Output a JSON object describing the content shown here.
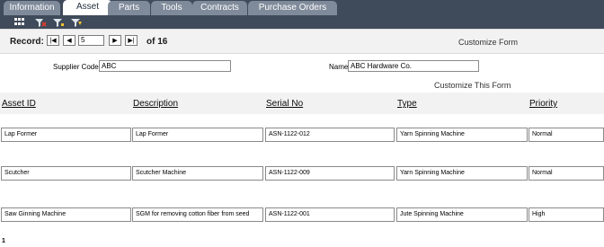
{
  "tabs": [
    {
      "label": "Information",
      "active": false
    },
    {
      "label": "Asset",
      "active": true
    },
    {
      "label": "Parts",
      "active": false
    },
    {
      "label": "Tools",
      "active": false
    },
    {
      "label": "Contracts",
      "active": false
    },
    {
      "label": "Purchase Orders",
      "active": false
    }
  ],
  "toolbar": {
    "icons": [
      "grid-view-icon",
      "clear-filter-icon",
      "filter-icon",
      "advanced-filter-icon"
    ]
  },
  "record": {
    "label": "Record:",
    "current": "5",
    "of_text": "of 16",
    "first": "|◀",
    "prev": "◀",
    "next": "▶",
    "last": "▶|"
  },
  "customize_form": "Customize Form",
  "supplier": {
    "code_label": "Supplier Code",
    "code_value": "ABC",
    "name_label": "Name",
    "name_value": "ABC Hardware Co."
  },
  "customize_this_form": "Customize This Form",
  "grid": {
    "columns": [
      "Asset ID",
      "Description",
      "Serial No",
      "Type",
      "Priority"
    ],
    "rows": [
      [
        "Lap Former",
        "Lap Former",
        "ASN-1122-012",
        "Yarn Spinning Machine",
        "Normal"
      ],
      [
        "Scutcher",
        "Scutcher Machine",
        "ASN-1122-009",
        "Yarn Spinning Machine",
        "Normal"
      ],
      [
        "Saw Ginning Machine",
        "SGM for removing cotton fiber from seed",
        "ASN-1122-001",
        "Jute Spinning Machine",
        "High"
      ]
    ]
  },
  "page_number": "1",
  "colors": {
    "tabbar": "#3f4a5a",
    "tab": "#7f8a9a",
    "active_tab": "#ffffff",
    "panel": "#f2f2f2"
  }
}
